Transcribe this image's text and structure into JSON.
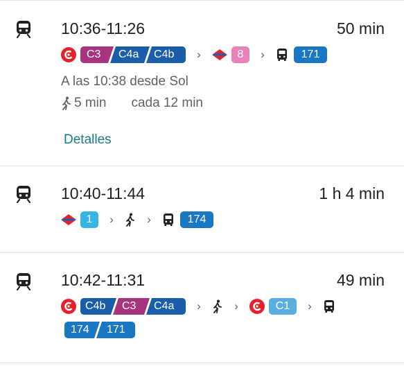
{
  "routes": [
    {
      "time": "10:36-11:26",
      "duration": "50 min",
      "seg1": [
        "C3",
        "C4a",
        "C4b"
      ],
      "metro_line": "8",
      "bus_line": "171",
      "departure": "A las 10:38 desde Sol",
      "walk": "5 min",
      "frequency": "cada 12 min",
      "details_label": "Detalles"
    },
    {
      "time": "10:40-11:44",
      "duration": "1 h 4 min",
      "metro_line": "1",
      "bus_line": "174"
    },
    {
      "time": "10:42-11:31",
      "duration": "49 min",
      "seg1": [
        "C4b",
        "C3",
        "C4a"
      ],
      "cercanias_line": "C1",
      "bus_lines": [
        "174",
        "171"
      ]
    }
  ],
  "icons": {
    "train": "train-icon",
    "cercanias": "renfe-cercanias-icon",
    "metro": "metro-madrid-icon",
    "bus": "bus-icon",
    "walk": "walk-icon",
    "chevron": "chevron-right-icon"
  },
  "colors": {
    "cercanias_red": "#e4222b",
    "line_c3": "#a6357e",
    "line_c4": "#1a5da8",
    "line_c1": "#5aaede",
    "metro_8": "#e982b7",
    "metro_1": "#36b5e5",
    "bus": "#1a78c2",
    "link": "#1b7c83"
  }
}
